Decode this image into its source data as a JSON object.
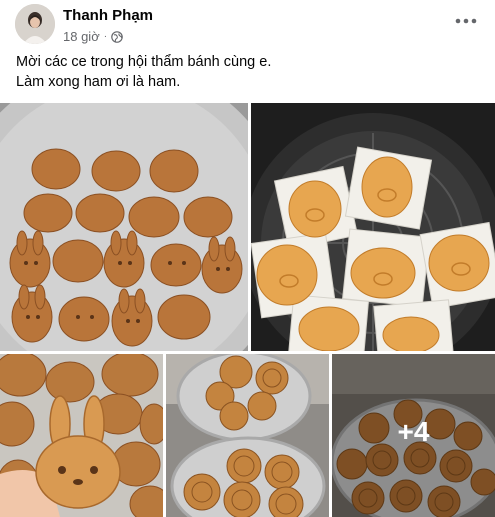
{
  "post": {
    "author": "Thanh Phạm",
    "timestamp": "18 giờ",
    "privacy_icon": "globe-icon",
    "more_icon": "more-options-icon",
    "caption_lines": [
      "Mời các ce trong hội thẩm bánh cùng e.",
      "Làm xong ham ơi là ham."
    ]
  },
  "gallery": {
    "extra_count_label": "+4"
  },
  "colors": {
    "text_primary": "#050505",
    "text_secondary": "#65676b",
    "cake_brown": "#b9763a",
    "tray_silver": "#c8c8c8"
  }
}
